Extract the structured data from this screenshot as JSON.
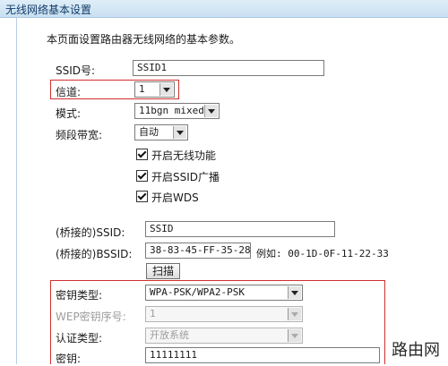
{
  "title": "无线网络基本设置",
  "description": "本页面设置路由器无线网络的基本参数。",
  "ssid": {
    "label": "SSID号:",
    "value": "SSID1"
  },
  "channel": {
    "label": "信道:",
    "value": "1"
  },
  "mode": {
    "label": "模式:",
    "value": "11bgn mixed"
  },
  "bandwidth": {
    "label": "频段带宽:",
    "value": "自动"
  },
  "checkboxes": {
    "enable_wireless": "开启无线功能",
    "enable_ssid_broadcast": "开启SSID广播",
    "enable_wds": "开启WDS"
  },
  "bridged_ssid": {
    "label": "(桥接的)SSID:",
    "value": "SSID"
  },
  "bridged_bssid": {
    "label": "(桥接的)BSSID:",
    "value": "38-83-45-FF-35-28",
    "example": "例如: 00-1D-0F-11-22-33"
  },
  "scan_button": "扫描",
  "key_type": {
    "label": "密钥类型:",
    "value": "WPA-PSK/WPA2-PSK"
  },
  "wep_index": {
    "label": "WEP密钥序号:",
    "value": "1"
  },
  "auth_type": {
    "label": "认证类型:",
    "value": "开放系统"
  },
  "key": {
    "label": "密钥:",
    "value": "11111111"
  },
  "watermark": "路由网",
  "colors": {
    "highlight": "#d0302d",
    "titlebar": "#c9e0f1"
  }
}
